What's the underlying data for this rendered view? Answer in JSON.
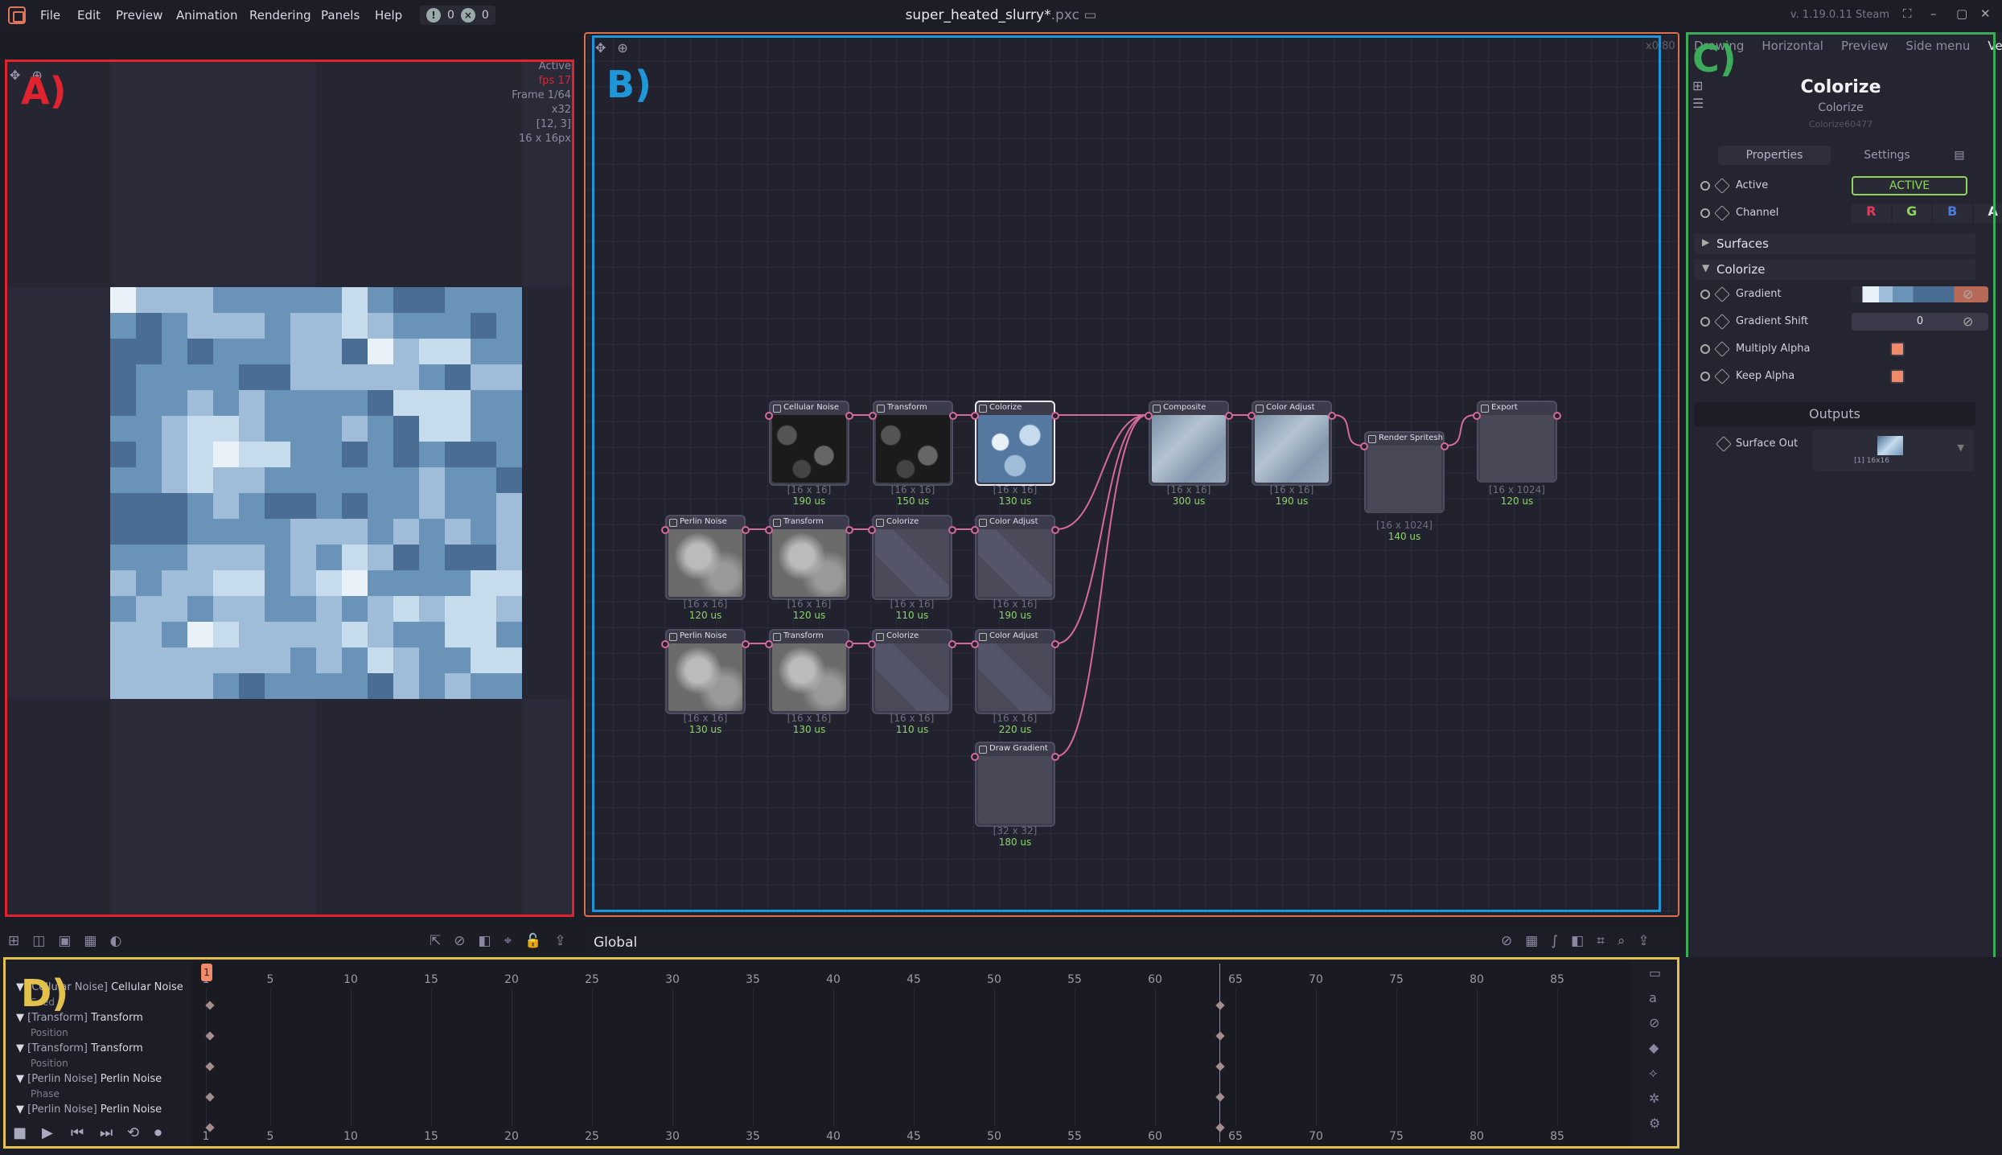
{
  "menubar": {
    "items": [
      "File",
      "Edit",
      "Preview",
      "Animation",
      "Rendering",
      "Panels",
      "Help"
    ],
    "warnings": "0",
    "errors": "0",
    "file_name": "super_heated_slurry*",
    "file_ext": ".pxc",
    "version": "v. 1.19.0.11 Steam"
  },
  "preview": {
    "label": "A)",
    "info_active": "Active",
    "info_fps": "fps 17",
    "info_frame": "Frame 1/64",
    "info_scale": "x32",
    "info_pos": "[12, 3]",
    "info_size": "16 x 16px"
  },
  "graph": {
    "label": "B)",
    "zoom": "x0.80",
    "context": "Global",
    "nodes": [
      {
        "name": "Cellular Noise",
        "dims": "[16 x 16]",
        "time": "190 us"
      },
      {
        "name": "Transform",
        "dims": "[16 x 16]",
        "time": "150 us"
      },
      {
        "name": "Colorize",
        "dims": "[16 x 16]",
        "time": "130 us"
      },
      {
        "name": "Composite",
        "dims": "[16 x 16]",
        "time": "300 us"
      },
      {
        "name": "Color Adjust",
        "dims": "[16 x 16]",
        "time": "190 us"
      },
      {
        "name": "Render Spritesheet",
        "dims": "[16 x 1024]",
        "time": "140 us"
      },
      {
        "name": "Export",
        "dims": "[16 x 1024]",
        "time": "120 us"
      },
      {
        "name": "Perlin Noise",
        "dims": "[16 x 16]",
        "time": "120 us"
      },
      {
        "name": "Transform",
        "dims": "[16 x 16]",
        "time": "120 us"
      },
      {
        "name": "Colorize",
        "dims": "[16 x 16]",
        "time": "110 us"
      },
      {
        "name": "Color Adjust",
        "dims": "[16 x 16]",
        "time": "190 us"
      },
      {
        "name": "Perlin Noise",
        "dims": "[16 x 16]",
        "time": "130 us"
      },
      {
        "name": "Transform",
        "dims": "[16 x 16]",
        "time": "130 us"
      },
      {
        "name": "Colorize",
        "dims": "[16 x 16]",
        "time": "110 us"
      },
      {
        "name": "Color Adjust",
        "dims": "[16 x 16]",
        "time": "220 us"
      },
      {
        "name": "Draw Gradient",
        "dims": "[32 x 32]",
        "time": "180 us"
      }
    ]
  },
  "inspector": {
    "label": "C)",
    "tabs": [
      "Drawing",
      "Horizontal",
      "Preview",
      "Side menu",
      "Vertic"
    ],
    "title": "Colorize",
    "subtitle": "Colorize",
    "node_id": "Colorize60477",
    "subtabs": [
      "Properties",
      "Settings"
    ],
    "active_label": "Active",
    "active_value": "ACTIVE",
    "channel_label": "Channel",
    "channels": [
      "R",
      "G",
      "B",
      "A"
    ],
    "sec_surfaces": "Surfaces",
    "sec_colorize": "Colorize",
    "gradient_label": "Gradient",
    "gradient_shift_label": "Gradient Shift",
    "gradient_shift_value": "0",
    "multiply_alpha_label": "Multiply Alpha",
    "keep_alpha_label": "Keep Alpha",
    "outputs_label": "Outputs",
    "surface_out_label": "Surface Out",
    "surface_out_thumb": "[1] 16x16",
    "colors": {
      "accent": "#e0775a",
      "active_border": "#8fd45b"
    }
  },
  "timeline": {
    "label": "D)",
    "ticks": [
      "1",
      "5",
      "10",
      "15",
      "20",
      "25",
      "30",
      "35",
      "40",
      "45",
      "50",
      "55",
      "60",
      "65",
      "70",
      "75",
      "80",
      "85"
    ],
    "playhead": "1",
    "tracks": [
      {
        "type": "[Cellular Noise]",
        "name": "Cellular Noise",
        "sub": "Seed"
      },
      {
        "type": "[Transform]",
        "name": "Transform",
        "sub": "Position"
      },
      {
        "type": "[Transform]",
        "name": "Transform",
        "sub": "Position"
      },
      {
        "type": "[Perlin Noise]",
        "name": "Perlin Noise",
        "sub": "Phase"
      },
      {
        "type": "[Perlin Noise]",
        "name": "Perlin Noise",
        "sub": ""
      }
    ]
  }
}
